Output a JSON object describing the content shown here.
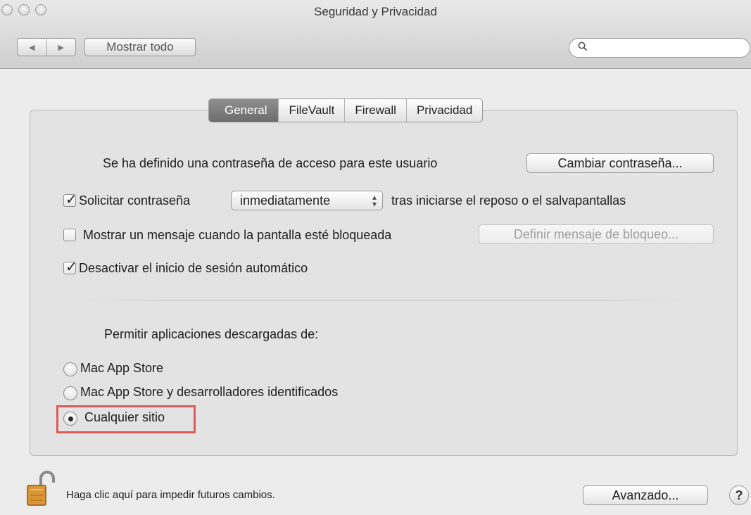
{
  "window": {
    "title": "Seguridad y Privacidad"
  },
  "toolbar": {
    "back_icon": "chevron-left-icon",
    "forward_icon": "chevron-right-icon",
    "show_all_label": "Mostrar todo",
    "search_placeholder": "",
    "search_value": ""
  },
  "tabs": [
    {
      "label": "General",
      "active": true
    },
    {
      "label": "FileVault",
      "active": false
    },
    {
      "label": "Firewall",
      "active": false
    },
    {
      "label": "Privacidad",
      "active": false
    }
  ],
  "general": {
    "password_set_text": "Se ha definido una contraseña de acceso para este usuario",
    "change_password_label": "Cambiar contraseña...",
    "require_password": {
      "label": "Solicitar contraseña",
      "checked": true
    },
    "require_delay": {
      "value": "inmediatamente"
    },
    "require_suffix": "tras iniciarse el reposo o el salvapantallas",
    "show_message": {
      "label": "Mostrar un mensaje cuando la pantalla esté bloqueada",
      "checked": false
    },
    "set_message_label": "Definir mensaje de bloqueo...",
    "disable_autologin": {
      "label": "Desactivar el inicio de sesión automático",
      "checked": true
    },
    "allow_apps_heading": "Permitir aplicaciones descargadas de:",
    "allow_options": [
      {
        "label": "Mac App Store",
        "selected": false
      },
      {
        "label": "Mac App Store y desarrolladores identificados",
        "selected": false
      },
      {
        "label": "Cualquier sitio",
        "selected": true
      }
    ]
  },
  "footer": {
    "lock_text": "Haga clic aquí para impedir futuros cambios.",
    "advanced_label": "Avanzado...",
    "help_label": "?"
  },
  "colors": {
    "highlight": "#e05a5a",
    "active_tab": "#7a7a7a"
  }
}
